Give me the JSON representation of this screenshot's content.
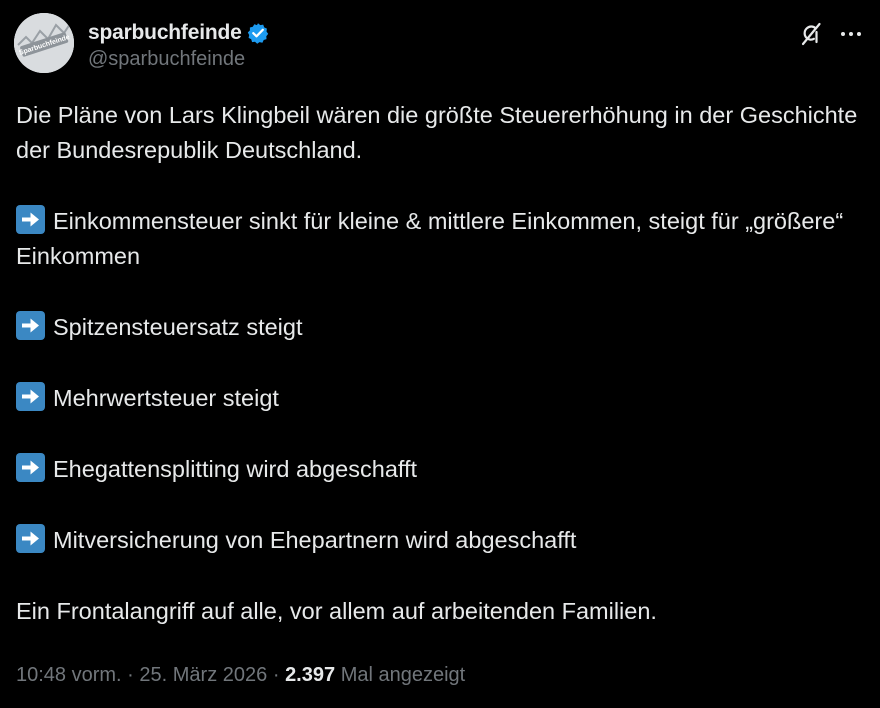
{
  "author": {
    "display_name": "sparbuchfeinde",
    "handle": "@sparbuchfeinde",
    "avatar_text": "Sparbuchfeinde",
    "verified": true,
    "verified_color": "#1d9bf0"
  },
  "post": {
    "intro": "Die Pläne von Lars Klingbeil wären die größte Steuererhöhung in der Geschichte der Bundesrepublik Deutschland.",
    "bullets": [
      {
        "icon": "arrow-right-emoji",
        "text": "Einkommensteuer sinkt für kleine & mittlere Einkommen, steigt für „größere“ Einkommen"
      },
      {
        "icon": "arrow-right-emoji",
        "text": "Spitzensteuersatz steigt"
      },
      {
        "icon": "arrow-right-emoji",
        "text": "Mehrwertsteuer steigt"
      },
      {
        "icon": "arrow-right-emoji",
        "text": "Ehegattensplitting wird abgeschafft"
      },
      {
        "icon": "arrow-right-emoji",
        "text": "Mitversicherung von Ehepartnern wird abgeschafft"
      }
    ],
    "closing": "Ein Frontalangriff auf alle, vor allem auf arbeitenden Familien."
  },
  "meta": {
    "time": "10:48 vorm.",
    "separator": "·",
    "date": "25. März 2026",
    "views_count": "2.397",
    "views_label": "Mal angezeigt"
  },
  "icons": {
    "grok": "grok-icon",
    "more": "more-options-icon",
    "bullet": "arrow-right-emoji"
  },
  "colors": {
    "background": "#000000",
    "text": "#e7e9ea",
    "secondary_text": "#71767b",
    "arrow_emoji_bg": "#3b88c3"
  }
}
